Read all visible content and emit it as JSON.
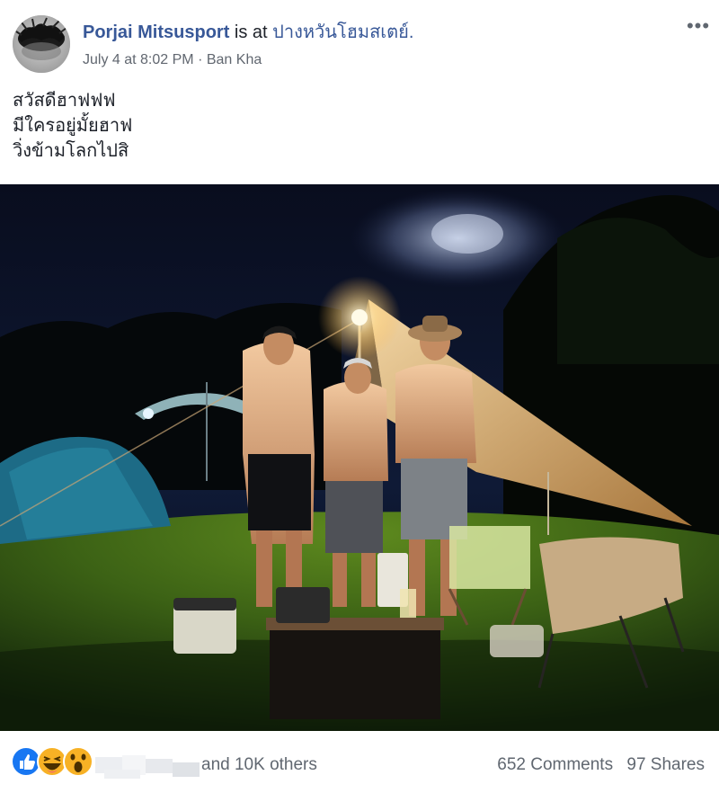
{
  "post": {
    "author": "Porjai Mitsusport",
    "is_at": "is at",
    "place": "ปางหวันโฮมสเตย์.",
    "date": "July 4 at 8:02 PM",
    "separator": "·",
    "location": "Ban Kha",
    "more_label": "•••",
    "text_lines": [
      "สวัสดีฮาฟฟฟ",
      "มีใครอยู่มั้ยฮาฟ",
      "วิ่งข้ามโลกไปสิ"
    ]
  },
  "reactions": {
    "icons": [
      "like-icon",
      "haha-icon",
      "wow-icon"
    ],
    "others": "and 10K others",
    "comments": "652 Comments",
    "shares": "97 Shares"
  },
  "colors": {
    "link": "#385898",
    "meta": "#606770",
    "like": "#1877f2",
    "emoji": "#f7b125"
  }
}
